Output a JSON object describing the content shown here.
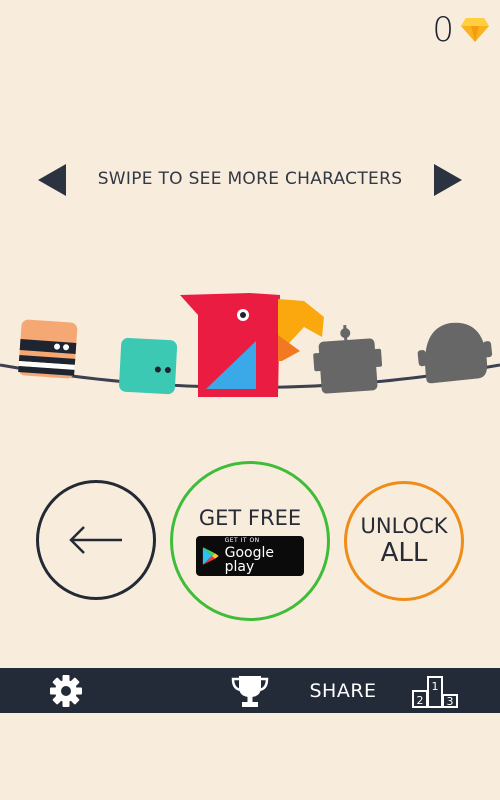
{
  "hud": {
    "gem_count": "0",
    "gem_icon": "diamond-icon",
    "gem_color": "#f7b21e"
  },
  "swipe": {
    "text": "SWIPE TO SEE MORE CHARACTERS",
    "left_icon": "arrow-left-icon",
    "right_icon": "arrow-right-icon"
  },
  "characters": [
    {
      "name": "robber",
      "state": "unlocked"
    },
    {
      "name": "teal-block",
      "state": "unlocked"
    },
    {
      "name": "red-parrot",
      "state": "selected"
    },
    {
      "name": "robot",
      "state": "locked"
    },
    {
      "name": "bald-head",
      "state": "locked"
    }
  ],
  "buttons": {
    "back_icon": "back-arrow-icon",
    "get_free_label": "GET FREE",
    "gplay_small": "GET IT ON",
    "gplay_big": "Google play",
    "unlock_line1": "UNLOCK",
    "unlock_line2": "ALL"
  },
  "bottom_bar": {
    "settings_icon": "gear-icon",
    "trophy_icon": "trophy-icon",
    "share_label": "SHARE",
    "leaderboard_icon": "podium-icon",
    "podium_numbers": [
      "2",
      "1",
      "3"
    ]
  },
  "colors": {
    "background": "#f8eddc",
    "bar": "#232a38",
    "green": "#3fbd3a",
    "orange": "#f08c1a",
    "parrot_red": "#ea1c41",
    "teal": "#3cc9b4"
  }
}
